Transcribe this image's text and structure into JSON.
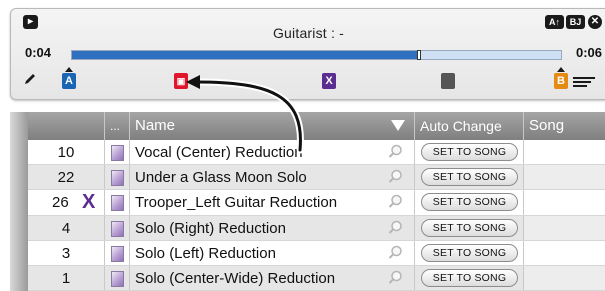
{
  "panel": {
    "title": "Guitarist : -",
    "time_start": "0:04",
    "time_end": "0:06",
    "progress": 0.71,
    "play_icon": "play-icon",
    "top_icons": [
      "ab-repeat-icon",
      "bj-icon",
      "close-icon"
    ],
    "markers": {
      "a_label": "A",
      "red_label": "▣",
      "x_label": "X",
      "b_label": "B"
    },
    "colors": {
      "progress_fill": "#2f6fbf",
      "marker_a": "#1b65b5",
      "marker_red": "#e0162b",
      "marker_x": "#5b2d90",
      "marker_b": "#e58a12"
    }
  },
  "table": {
    "headers": {
      "dots": "...",
      "name": "Name",
      "auto_change": "Auto Change",
      "song": "Song"
    },
    "button_label": "SET TO SONG",
    "rows": [
      {
        "num": "10",
        "name": "Vocal (Center) Reduction",
        "marked": false
      },
      {
        "num": "22",
        "name": "Under a Glass Moon Solo",
        "marked": false
      },
      {
        "num": "26",
        "name": "Trooper_Left Guitar Reduction",
        "marked": true,
        "mark": "X"
      },
      {
        "num": "4",
        "name": "Solo (Right) Reduction",
        "marked": false
      },
      {
        "num": "3",
        "name": "Solo (Left) Reduction",
        "marked": false
      },
      {
        "num": "1",
        "name": "Solo (Center-Wide) Reduction",
        "marked": false
      }
    ]
  }
}
